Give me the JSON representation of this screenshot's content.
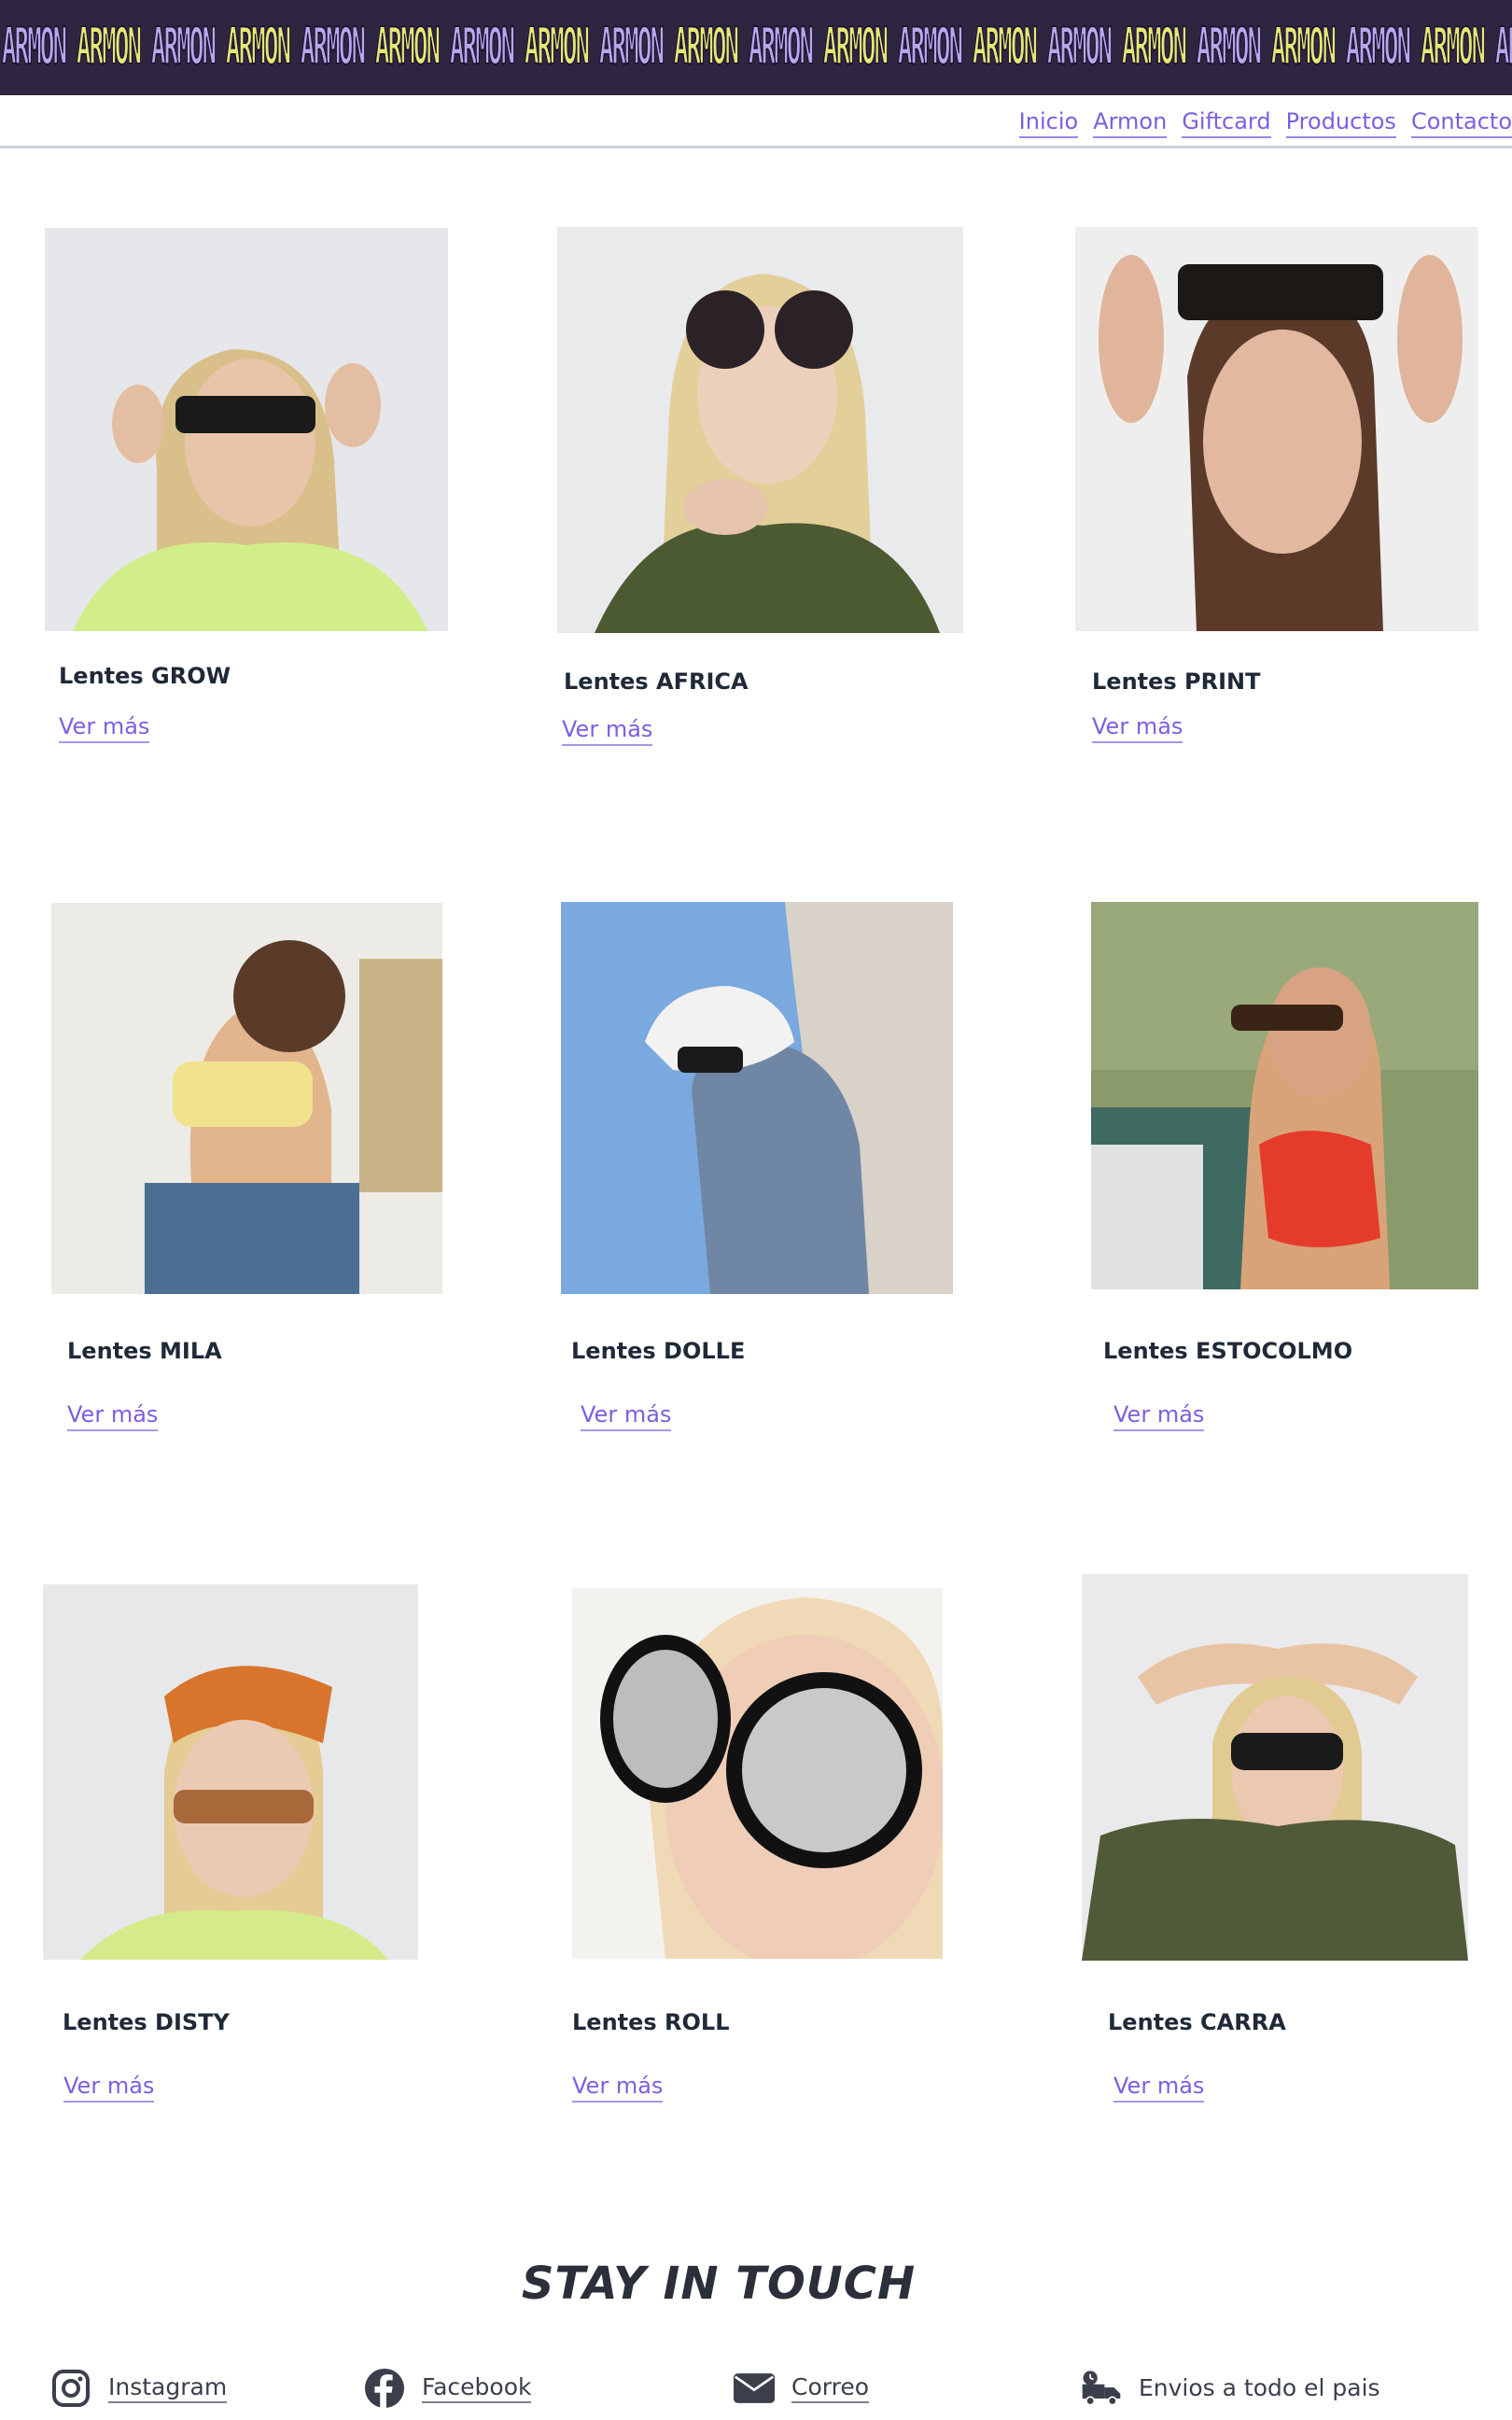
{
  "banner": {
    "logo_text": "ARMON",
    "tiles": [
      "purple",
      "yellow",
      "purple",
      "yellow",
      "purple",
      "yellow",
      "purple",
      "yellow",
      "purple",
      "yellow",
      "purple",
      "yellow",
      "purple",
      "yellow",
      "purple",
      "yellow",
      "purple",
      "yellow",
      "purple",
      "yellow",
      "purple"
    ]
  },
  "nav": {
    "items": [
      {
        "label": "Inicio"
      },
      {
        "label": "Armon"
      },
      {
        "label": "Giftcard"
      },
      {
        "label": "Productos"
      },
      {
        "label": "Contacto"
      }
    ]
  },
  "products": [
    {
      "title": "Lentes GROW",
      "link": "Ver más"
    },
    {
      "title": "Lentes AFRICA",
      "link": "Ver más"
    },
    {
      "title": "Lentes PRINT",
      "link": "Ver más"
    },
    {
      "title": "Lentes MILA",
      "link": "Ver más"
    },
    {
      "title": "Lentes DOLLE",
      "link": "Ver más"
    },
    {
      "title": "Lentes ESTOCOLMO",
      "link": "Ver más"
    },
    {
      "title": "Lentes DISTY",
      "link": "Ver más"
    },
    {
      "title": "Lentes ROLL",
      "link": "Ver más"
    },
    {
      "title": "Lentes CARRA",
      "link": "Ver más"
    }
  ],
  "footer": {
    "title": "STAY IN TOUCH",
    "items": [
      {
        "label": "Instagram",
        "icon": "instagram-icon"
      },
      {
        "label": "Facebook",
        "icon": "facebook-icon"
      },
      {
        "label": "Correo",
        "icon": "mail-icon"
      },
      {
        "label": "Envios a todo el pais",
        "icon": "delivery-truck-icon"
      }
    ]
  },
  "colors": {
    "accent": "#7b5fe0",
    "banner_bg": "#2e2540",
    "logo_purple": "#b9a6ec",
    "logo_yellow": "#e6e675"
  }
}
